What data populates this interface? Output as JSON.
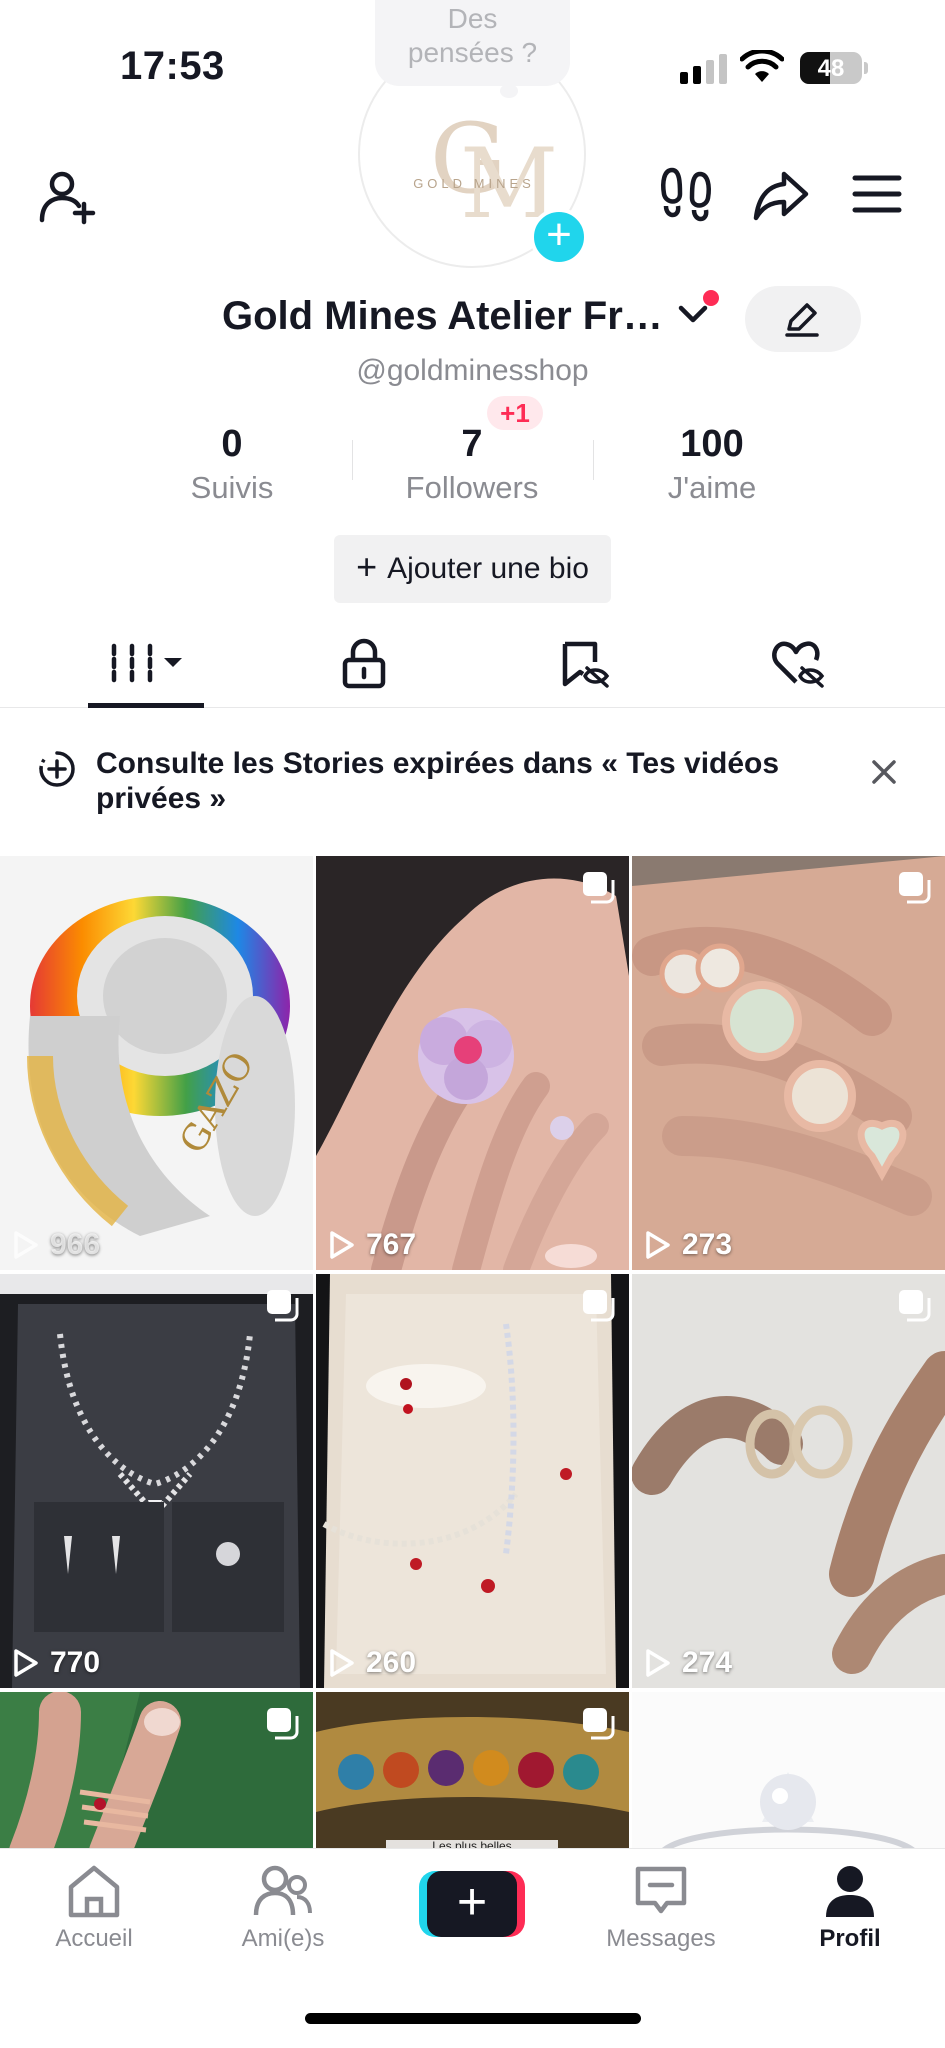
{
  "status_bar": {
    "time": "17:53",
    "battery": "48"
  },
  "profile": {
    "thought_bubble": [
      "Des",
      "pensées ?"
    ],
    "avatar_logo_text": "GOLD MINES",
    "name": "Gold Mines Atelier Fr…",
    "handle": "@goldminesshop",
    "followers_badge": "+1",
    "stats": [
      {
        "value": "0",
        "label": "Suivis"
      },
      {
        "value": "7",
        "label": "Followers"
      },
      {
        "value": "100",
        "label": "J'aime"
      }
    ],
    "bio_button": "Ajouter une bio"
  },
  "tabs": [
    {
      "name": "tab-videos",
      "icon": "grid-icon",
      "active": true
    },
    {
      "name": "tab-private",
      "icon": "lock-icon"
    },
    {
      "name": "tab-reposts",
      "icon": "bookmark-hidden-icon"
    },
    {
      "name": "tab-liked",
      "icon": "heart-hidden-icon"
    }
  ],
  "banner": {
    "text": "Consulte les Stories expirées dans « Tes vidéos privées »"
  },
  "videos": [
    {
      "views": "966",
      "subject": "lion ring"
    },
    {
      "views": "767",
      "subject": "flower ring"
    },
    {
      "views": "273",
      "subject": "diamond rings"
    },
    {
      "views": "770",
      "subject": "necklace set"
    },
    {
      "views": "260",
      "subject": "ruby set"
    },
    {
      "views": "274",
      "subject": "gold bands"
    },
    {
      "views": "",
      "subject": "stack rings"
    },
    {
      "views": "",
      "subject": "gem chain",
      "caption": "Les plus belles"
    },
    {
      "views": "",
      "subject": "solitaire"
    }
  ],
  "nav": [
    {
      "label": "Accueil"
    },
    {
      "label": "Ami(e)s"
    },
    {
      "label": ""
    },
    {
      "label": "Messages"
    },
    {
      "label": "Profil"
    }
  ],
  "colors": {
    "accent": "#fe2c55",
    "cyan": "#20d5ec",
    "text": "#161823",
    "secondary": "#8a8b91"
  }
}
